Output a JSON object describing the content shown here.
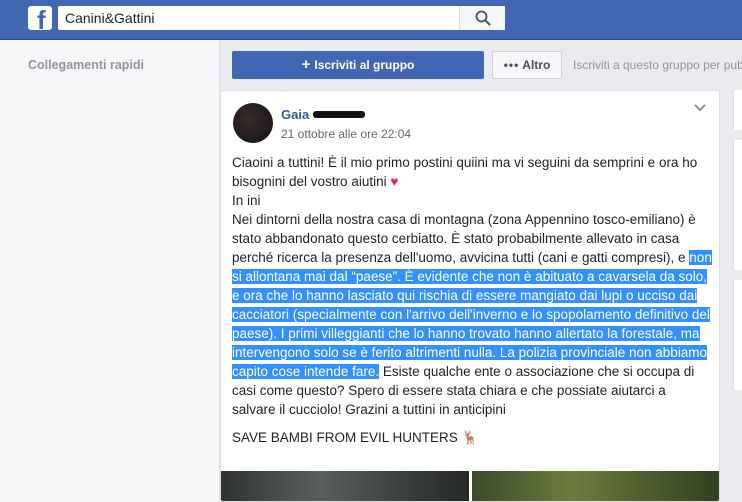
{
  "topbar": {
    "logo_letter": "f",
    "search_value": "Canini&Gattini"
  },
  "left_nav": {
    "quick_links_label": "Collegamenti rapidi"
  },
  "group_actions": {
    "join_label": "Iscriviti al gruppo",
    "other_label": "Altro",
    "promo_text": "Iscriviti a questo gruppo per pub"
  },
  "post": {
    "author": "Gaia",
    "timestamp": "21 ottobre alle ore 22:04",
    "intro": "Ciaoini a tuttini! È il mio primo postini quiini ma vi seguini da semprini e ora ho bisognini del vostro aiutini",
    "heart_emoji": "♥",
    "line_inini": "In ini",
    "para_plain_1": "Nei dintorni della nostra casa di montagna (zona Appennino tosco-emiliano) è stato abbandonato questo cerbiatto. È stato probabilmente allevato in casa perché ricerca la presenza dell'uomo, avvicina tutti (cani e gatti compresi), e ",
    "para_highlight": "non si allontana mai dal “paese”. È evidente che non è abituato a cavarsela da solo, e ora che lo hanno lasciato qui rischia di essere mangiato dai lupi o ucciso dai cacciatori (specialmente con l'arrivo dell'inverno e lo spopolamento definitivo del paese). I primi villeggianti che lo hanno trovato hanno allertato la forestale, ma intervengono solo se è ferito altrimenti nulla. La polizia provinciale non abbiamo capito cose intende fare.",
    "para_plain_2": " Esiste qualche ente o associazione che si occupa di casi come questo? Spero di essere stata chiara e che possiate aiutarci a salvare il cucciolo! Grazini a tuttini in anticipini",
    "save_line": "SAVE BAMBI FROM EVIL HUNTERS",
    "deer_emoji": "🦌"
  },
  "colors": {
    "brand_blue": "#4267b2",
    "selection_blue": "#3390ff",
    "link_blue": "#385898"
  }
}
